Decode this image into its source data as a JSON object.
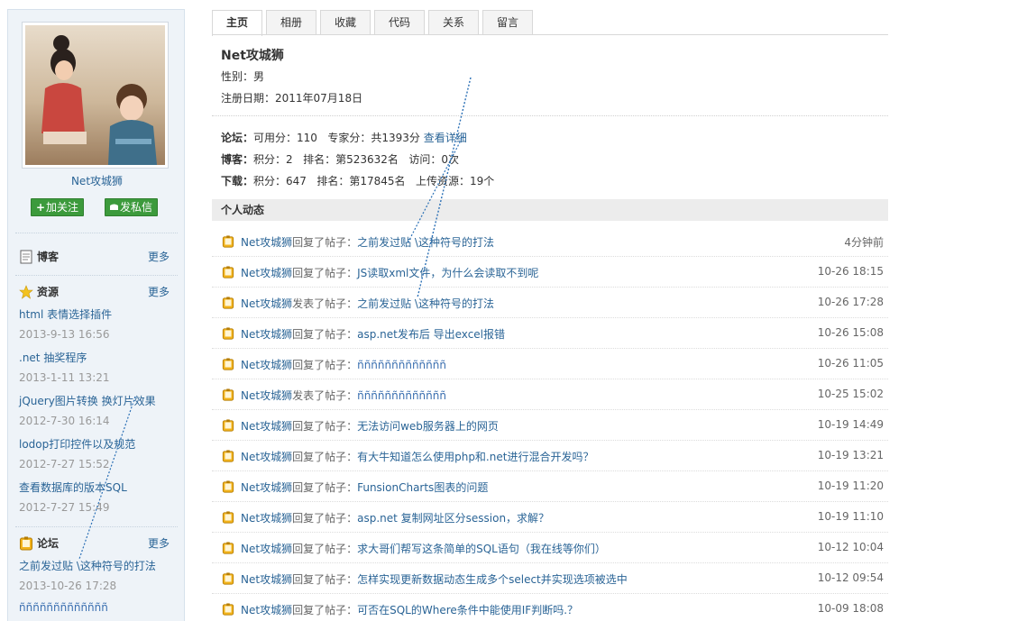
{
  "sidebar": {
    "username": "Net攻城狮",
    "follow_label": "加关注",
    "message_label": "发私信",
    "blog": {
      "title": "博客",
      "more": "更多"
    },
    "resources": {
      "title": "资源",
      "more": "更多",
      "items": [
        {
          "title": "html 表情选择插件",
          "date": "2013-9-13 16:56"
        },
        {
          "title": ".net 抽奖程序",
          "date": "2013-1-11 13:21"
        },
        {
          "title": "jQuery图片转换 换灯片效果",
          "date": "2012-7-30 16:14"
        },
        {
          "title": "lodop打印控件以及规范",
          "date": "2012-7-27 15:52"
        },
        {
          "title": "查看数据库的版本SQL",
          "date": "2012-7-27 15:49"
        }
      ]
    },
    "forum": {
      "title": "论坛",
      "more": "更多",
      "items": [
        {
          "title": "之前发过贴 \\这种符号的打法",
          "date": "2013-10-26 17:28"
        }
      ],
      "glitch_text": "ñññññññññññññ"
    }
  },
  "tabs": [
    "主页",
    "相册",
    "收藏",
    "代码",
    "关系",
    "留言"
  ],
  "profile": {
    "name": "Net攻城狮",
    "gender": "性别：男",
    "regdate": "注册日期：2011年07月18日"
  },
  "stats": {
    "forum": {
      "label": "论坛：",
      "text": "可用分：110   专家分：共1393分",
      "link": "查看详细"
    },
    "blog": {
      "label": "博客：",
      "text": "积分：2   排名：第523632名   访问：0次"
    },
    "download": {
      "label": "下载：",
      "text": "积分：647   排名：第17845名   上传资源：19个"
    }
  },
  "activity": {
    "header": "个人动态",
    "items": [
      {
        "user": "Net攻城狮",
        "verb": "回复了帖子：",
        "title": "之前发过贴 \\这种符号的打法",
        "time": "4分钟前"
      },
      {
        "user": "Net攻城狮",
        "verb": "回复了帖子：",
        "title": "JS读取xml文件，为什么会读取不到呢",
        "time": "10-26 18:15"
      },
      {
        "user": "Net攻城狮",
        "verb": "发表了帖子：",
        "title": "之前发过贴 \\这种符号的打法",
        "time": "10-26 17:28"
      },
      {
        "user": "Net攻城狮",
        "verb": "回复了帖子：",
        "title": "asp.net发布后 导出excel报错",
        "time": "10-26 15:08"
      },
      {
        "user": "Net攻城狮",
        "verb": "回复了帖子：",
        "title": "ñññññññññññññ",
        "time": "10-26 11:05"
      },
      {
        "user": "Net攻城狮",
        "verb": "发表了帖子：",
        "title": "ñññññññññññññ",
        "time": "10-25 15:02"
      },
      {
        "user": "Net攻城狮",
        "verb": "回复了帖子：",
        "title": "无法访问web服务器上的网页",
        "time": "10-19 14:49"
      },
      {
        "user": "Net攻城狮",
        "verb": "回复了帖子：",
        "title": "有大牛知道怎么使用php和.net进行混合开发吗？",
        "time": "10-19 13:21"
      },
      {
        "user": "Net攻城狮",
        "verb": "回复了帖子：",
        "title": "FunsionCharts图表的问题",
        "time": "10-19 11:20"
      },
      {
        "user": "Net攻城狮",
        "verb": "回复了帖子：",
        "title": "asp.net 复制网址区分session，求解？",
        "time": "10-19 11:10"
      },
      {
        "user": "Net攻城狮",
        "verb": "回复了帖子：",
        "title": "求大哥们帮写这条简单的SQL语句（我在线等你们）",
        "time": "10-12 10:04"
      },
      {
        "user": "Net攻城狮",
        "verb": "回复了帖子：",
        "title": "怎样实现更新数据动态生成多个select并实现选项被选中",
        "time": "10-12 09:54"
      },
      {
        "user": "Net攻城狮",
        "verb": "回复了帖子：",
        "title": "可否在SQL的Where条件中能使用IF判断吗.？",
        "time": "10-09 18:08"
      }
    ]
  },
  "colors": {
    "link": "#2a6496",
    "button_green": "#3c9a3c",
    "sidebar_bg": "#eef3f8"
  },
  "icons": {
    "blog": "blog-icon",
    "resources": "star-icon",
    "forum": "forum-icon",
    "activity": "post-icon"
  }
}
